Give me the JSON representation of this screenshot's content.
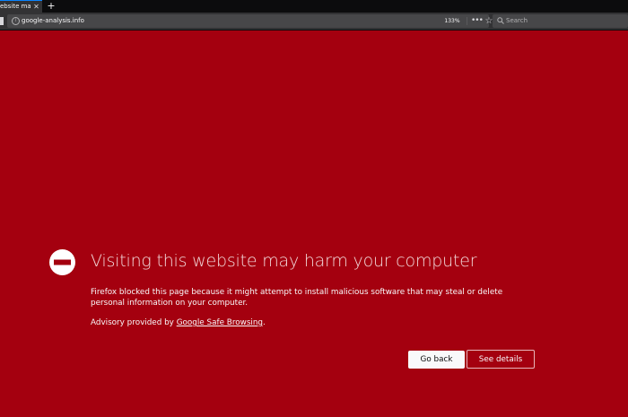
{
  "tab": {
    "title": "ebsite may",
    "close_glyph": "✕",
    "new_tab_glyph": "+"
  },
  "toolbar": {
    "url": "google-analysis.info",
    "zoom": "133%",
    "more_glyph": "•••",
    "bookmark_glyph": "☆",
    "search_placeholder": "Search"
  },
  "icons": {
    "identity": "info-icon",
    "block": "block-icon",
    "search": "search-icon"
  },
  "error": {
    "title": "Visiting this website may harm your computer",
    "description": "Firefox blocked this page because it might attempt to install malicious software that may steal or delete personal information on your computer.",
    "advisory_prefix": "Advisory provided by ",
    "advisory_link": "Google Safe Browsing",
    "advisory_suffix": "."
  },
  "buttons": {
    "go_back": "Go back",
    "see_details": "See details"
  },
  "colors": {
    "page_background": "#a4000f",
    "toolbar": "#323234",
    "urlbar": "#474749",
    "tab_accent": "#0a84ff"
  }
}
